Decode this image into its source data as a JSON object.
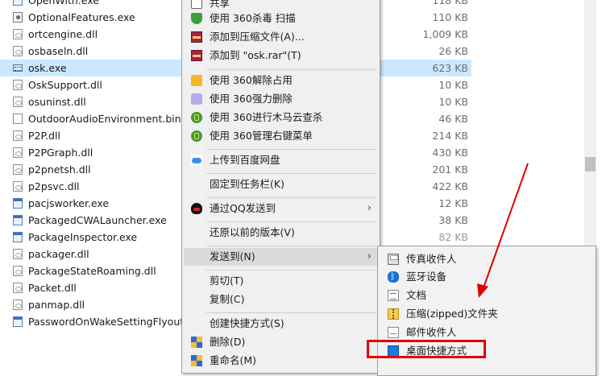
{
  "files": [
    {
      "name": "OpenWith.exe",
      "size": "118 KB",
      "icon": "exe-icon"
    },
    {
      "name": "OptionalFeatures.exe",
      "size": "110 KB",
      "icon": "gear-icon"
    },
    {
      "name": "ortcengine.dll",
      "size": "1,009 KB",
      "icon": "dll-icon"
    },
    {
      "name": "osbaseln.dll",
      "size": "26 KB",
      "icon": "dll-icon"
    },
    {
      "name": "osk.exe",
      "size": "623 KB",
      "icon": "keyboard-icon",
      "selected": true
    },
    {
      "name": "OskSupport.dll",
      "size": "10 KB",
      "icon": "dll-icon"
    },
    {
      "name": "osuninst.dll",
      "size": "10 KB",
      "icon": "dll-icon"
    },
    {
      "name": "OutdoorAudioEnvironment.bin",
      "size": "46 KB",
      "icon": "blank-file-icon"
    },
    {
      "name": "P2P.dll",
      "size": "214 KB",
      "icon": "dll-icon"
    },
    {
      "name": "P2PGraph.dll",
      "size": "430 KB",
      "icon": "dll-icon"
    },
    {
      "name": "p2pnetsh.dll",
      "size": "201 KB",
      "icon": "dll-icon"
    },
    {
      "name": "p2psvc.dll",
      "size": "422 KB",
      "icon": "dll-icon"
    },
    {
      "name": "pacjsworker.exe",
      "size": "12 KB",
      "icon": "exe-icon"
    },
    {
      "name": "PackagedCWALauncher.exe",
      "size": "38 KB",
      "icon": "exe-icon"
    },
    {
      "name": "PackageInspector.exe",
      "size": "82 KB",
      "icon": "exe-icon"
    },
    {
      "name": "packager.dll",
      "size": "",
      "icon": "dll-icon"
    },
    {
      "name": "PackageStateRoaming.dll",
      "size": "",
      "icon": "dll-icon"
    },
    {
      "name": "Packet.dll",
      "size": "",
      "icon": "dll-icon"
    },
    {
      "name": "panmap.dll",
      "size": "",
      "icon": "dll-icon"
    },
    {
      "name": "PasswordOnWakeSettingFlyout.e",
      "size": "",
      "icon": "exe-icon"
    }
  ],
  "context_menu": {
    "items": [
      {
        "label": "共享",
        "icon": "share-icon"
      },
      {
        "label": "使用 360杀毒 扫描",
        "icon": "360-antivirus-icon"
      },
      {
        "label": "添加到压缩文件(A)...",
        "icon": "winrar-icon"
      },
      {
        "label": "添加到 \"osk.rar\"(T)",
        "icon": "winrar-icon"
      },
      {
        "label": "使用 360解除占用",
        "icon": "360-unlock-icon"
      },
      {
        "label": "使用 360强力删除",
        "icon": "360-delete-icon"
      },
      {
        "label": "使用 360进行木马云查杀",
        "icon": "360-icon"
      },
      {
        "label": "使用 360管理右键菜单",
        "icon": "360-icon"
      },
      {
        "label": "上传到百度网盘",
        "icon": "baidu-cloud-icon"
      },
      {
        "label": "固定到任务栏(K)",
        "icon": ""
      },
      {
        "label": "通过QQ发送到",
        "icon": "qq-icon"
      },
      {
        "label": "还原以前的版本(V)",
        "icon": ""
      },
      {
        "label": "发送到(N)",
        "icon": ""
      },
      {
        "label": "剪切(T)",
        "icon": ""
      },
      {
        "label": "复制(C)",
        "icon": ""
      },
      {
        "label": "创建快捷方式(S)",
        "icon": ""
      },
      {
        "label": "删除(D)",
        "icon": "uac-shield-icon"
      },
      {
        "label": "重命名(M)",
        "icon": "uac-shield-icon"
      }
    ]
  },
  "send_to_menu": {
    "items": [
      {
        "label": "传真收件人",
        "icon": "fax-icon"
      },
      {
        "label": "蓝牙设备",
        "icon": "bluetooth-icon"
      },
      {
        "label": "文档",
        "icon": "documents-icon"
      },
      {
        "label": "压缩(zipped)文件夹",
        "icon": "zip-folder-icon"
      },
      {
        "label": "邮件收件人",
        "icon": "mail-icon"
      },
      {
        "label": "桌面快捷方式",
        "icon": "desktop-icon"
      }
    ]
  },
  "colors": {
    "selection": "#cce8ff",
    "highlight": "#e00000"
  }
}
